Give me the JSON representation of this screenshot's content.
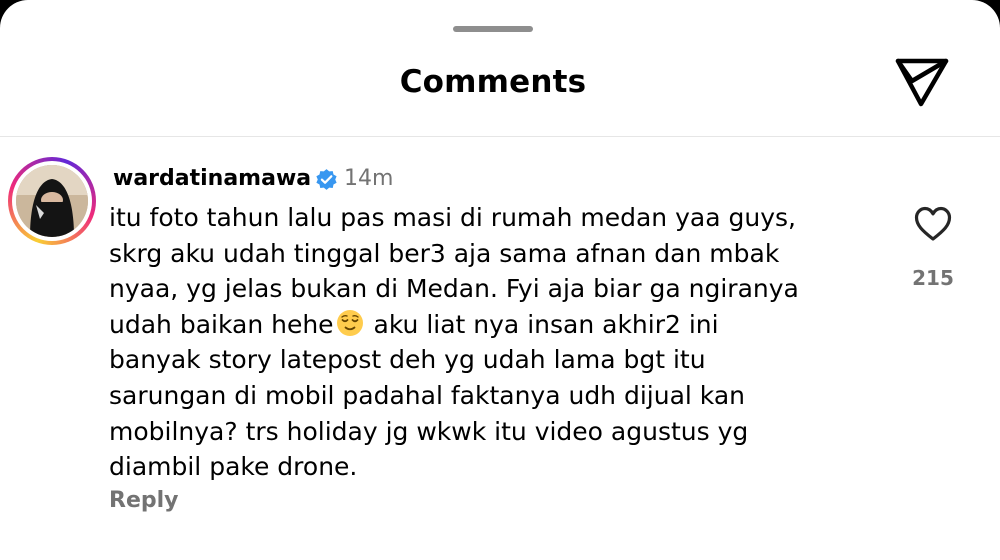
{
  "header": {
    "title": "Comments",
    "share_icon": "send-icon"
  },
  "comment": {
    "username": "wardatinamawa",
    "verified_icon": "verified-badge-icon",
    "timestamp": "14m",
    "lines": [
      "itu foto tahun lalu pas masi di rumah medan yaa guys,",
      "skrg aku udah tinggal ber3 aja sama afnan dan mbak",
      "nyaa, yg jelas bukan di Medan. Fyi aja biar ga ngiranya",
      "udah baikan hehe",
      " aku liat nya insan akhir2 ini",
      "banyak story latepost deh yg udah lama bgt itu",
      "sarungan di mobil padahal faktanya udh dijual kan",
      "mobilnya? trs holiday jg wkwk itu video agustus yg",
      "diambil pake drone."
    ],
    "emoji": "relieved-face-emoji",
    "like_count": "215",
    "reply_label": "Reply"
  },
  "colors": {
    "text": "#000000",
    "secondary": "#737373",
    "verified": "#3897f0",
    "divider": "#e6e6e6"
  }
}
